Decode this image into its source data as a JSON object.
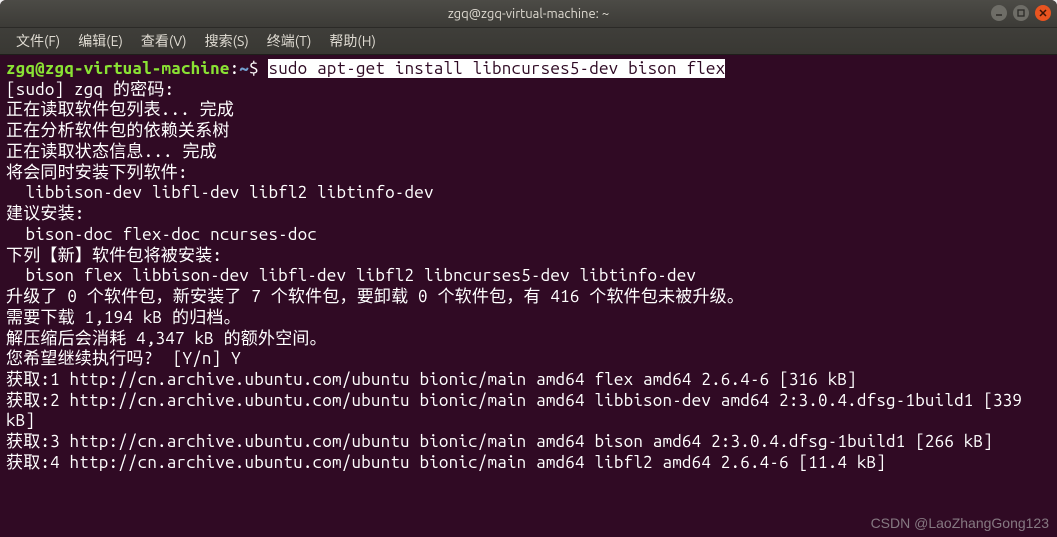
{
  "titlebar": {
    "title": "zgq@zgq-virtual-machine: ~"
  },
  "menubar": {
    "file": "文件(F)",
    "edit": "编辑(E)",
    "view": "查看(V)",
    "search": "搜索(S)",
    "terminal": "终端(T)",
    "help": "帮助(H)"
  },
  "prompt": {
    "userhost": "zgq@zgq-virtual-machine",
    "colon": ":",
    "path": "~",
    "dollar": "$ ",
    "command": "sudo apt-get install libncurses5-dev bison flex"
  },
  "lines": {
    "l1": "[sudo] zgq 的密码:",
    "l2": "正在读取软件包列表... 完成",
    "l3": "正在分析软件包的依赖关系树",
    "l4": "正在读取状态信息... 完成",
    "l5": "将会同时安装下列软件:",
    "l6": "  libbison-dev libfl-dev libfl2 libtinfo-dev",
    "l7": "建议安装:",
    "l8": "  bison-doc flex-doc ncurses-doc",
    "l9": "下列【新】软件包将被安装:",
    "l10": "  bison flex libbison-dev libfl-dev libfl2 libncurses5-dev libtinfo-dev",
    "l11": "升级了 0 个软件包，新安装了 7 个软件包，要卸载 0 个软件包，有 416 个软件包未被升级。",
    "l12": "需要下载 1,194 kB 的归档。",
    "l13": "解压缩后会消耗 4,347 kB 的额外空间。",
    "l14": "您希望继续执行吗?  [Y/n] Y",
    "l15": "获取:1 http://cn.archive.ubuntu.com/ubuntu bionic/main amd64 flex amd64 2.6.4-6 [316 kB]",
    "l16": "获取:2 http://cn.archive.ubuntu.com/ubuntu bionic/main amd64 libbison-dev amd64 2:3.0.4.dfsg-1build1 [339 kB]",
    "l17": "获取:3 http://cn.archive.ubuntu.com/ubuntu bionic/main amd64 bison amd64 2:3.0.4.dfsg-1build1 [266 kB]",
    "l18": "获取:4 http://cn.archive.ubuntu.com/ubuntu bionic/main amd64 libfl2 amd64 2.6.4-6 [11.4 kB]"
  },
  "watermark": "CSDN @LaoZhangGong123"
}
